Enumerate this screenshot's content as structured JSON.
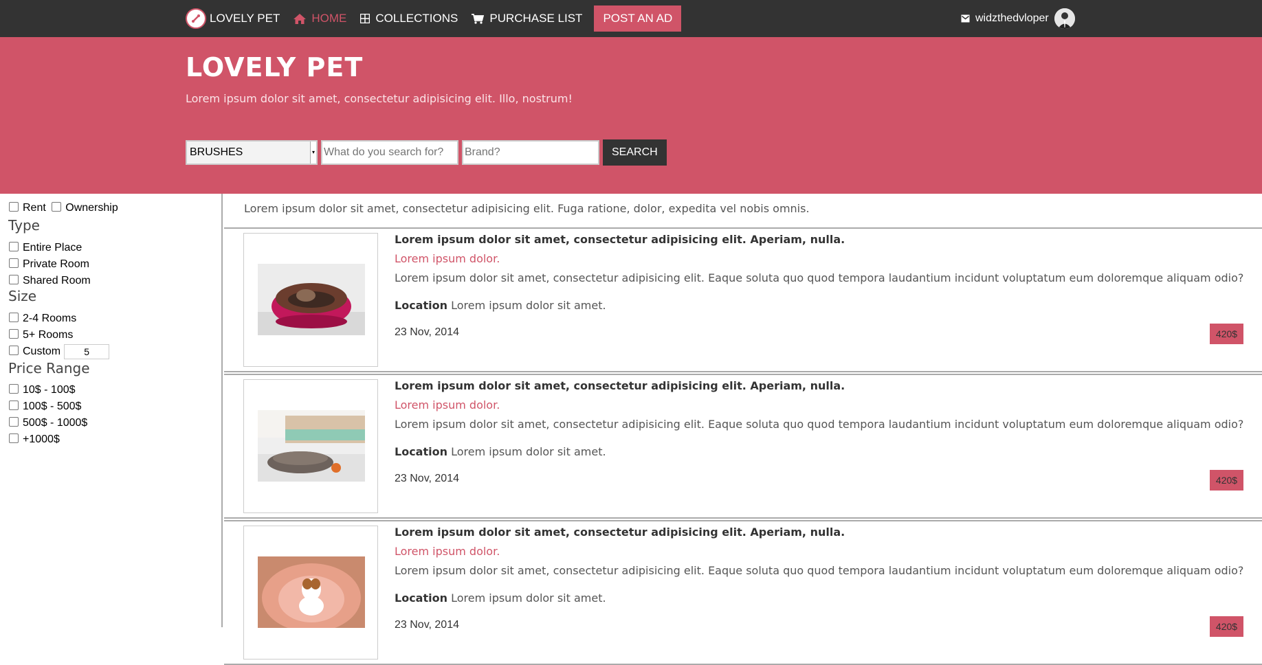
{
  "nav": {
    "brand": "LOVELY PET",
    "items": [
      {
        "label": "HOME",
        "icon": "home-icon"
      },
      {
        "label": "COLLECTIONS",
        "icon": "grid-icon"
      },
      {
        "label": "PURCHASE LIST",
        "icon": "cart-icon"
      }
    ],
    "post_ad": "POST AN AD",
    "username": "widzthedvloper"
  },
  "hero": {
    "title": "LOVELY PET",
    "subtitle": "Lorem ipsum dolor sit amet, consectetur adipisicing elit. Illo, nostrum!"
  },
  "search": {
    "category": "BRUSHES",
    "query_placeholder": "What do you search for?",
    "brand_placeholder": "Brand?",
    "button": "SEARCH"
  },
  "filters": {
    "rent": "Rent",
    "ownership": "Ownership",
    "type_heading": "Type",
    "types": [
      "Entire Place",
      "Private Room",
      "Shared Room"
    ],
    "size_heading": "Size",
    "sizes": [
      "2-4 Rooms",
      "5+ Rooms"
    ],
    "custom_label": "Custom",
    "custom_value": "5",
    "price_heading": "Price Range",
    "prices": [
      "10$ - 100$",
      "100$ - 500$",
      "500$ - 1000$",
      "+1000$"
    ]
  },
  "intro": "Lorem ipsum dolor sit amet, consectetur adipisicing elit. Fuga ratione, dolor, expedita vel nobis omnis.",
  "listings": [
    {
      "title": "Lorem ipsum dolor sit amet, consectetur adipisicing elit. Aperiam, nulla.",
      "subtitle": "Lorem ipsum dolor.",
      "description": "Lorem ipsum dolor sit amet, consectetur adipisicing elit. Eaque soluta quo quod tempora laudantium incidunt voluptatum eum doloremque aliquam odio?",
      "location_label": "Location",
      "location": "Lorem ipsum dolor sit amet.",
      "date": "23 Nov, 2014",
      "price": "420$"
    },
    {
      "title": "Lorem ipsum dolor sit amet, consectetur adipisicing elit. Aperiam, nulla.",
      "subtitle": "Lorem ipsum dolor.",
      "description": "Lorem ipsum dolor sit amet, consectetur adipisicing elit. Eaque soluta quo quod tempora laudantium incidunt voluptatum eum doloremque aliquam odio?",
      "location_label": "Location",
      "location": "Lorem ipsum dolor sit amet.",
      "date": "23 Nov, 2014",
      "price": "420$"
    },
    {
      "title": "Lorem ipsum dolor sit amet, consectetur adipisicing elit. Aperiam, nulla.",
      "subtitle": "Lorem ipsum dolor.",
      "description": "Lorem ipsum dolor sit amet, consectetur adipisicing elit. Eaque soluta quo quod tempora laudantium incidunt voluptatum eum doloremque aliquam odio?",
      "location_label": "Location",
      "location": "Lorem ipsum dolor sit amet.",
      "date": "23 Nov, 2014",
      "price": "420$"
    }
  ],
  "colors": {
    "accent": "#d05468",
    "navbar": "#333333"
  }
}
